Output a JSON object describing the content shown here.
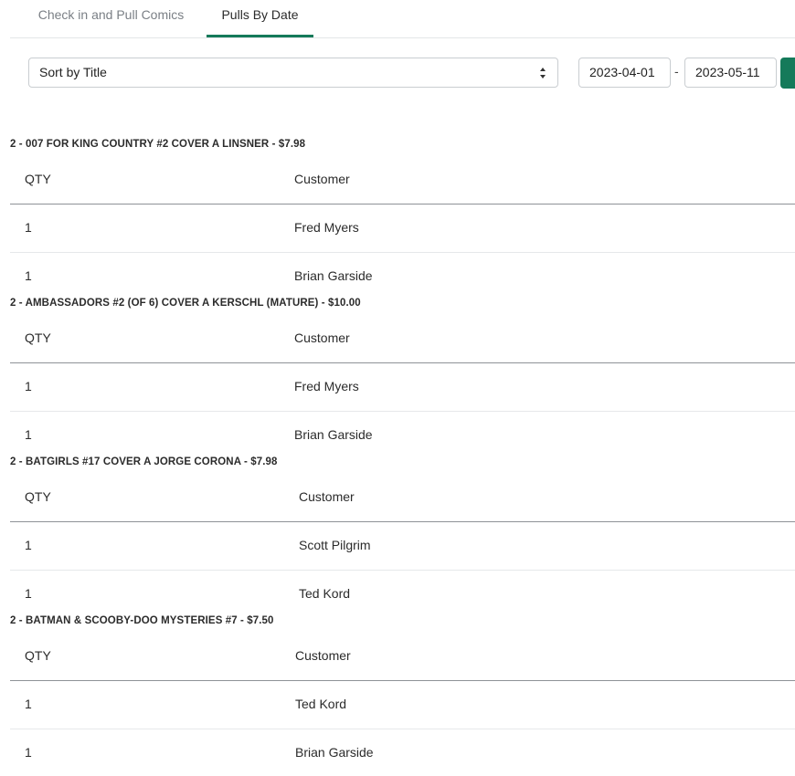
{
  "tabs": [
    {
      "label": "Check in and Pull Comics",
      "active": false
    },
    {
      "label": "Pulls By Date",
      "active": true
    }
  ],
  "filters": {
    "sort_label": "Sort by Title",
    "start_date": "2023-04-01",
    "end_date": "2023-05-11",
    "date_separator": "-"
  },
  "colors": {
    "accent": "#157a5a"
  },
  "table_headers": {
    "qty": "QTY",
    "customer": "Customer"
  },
  "groups": [
    {
      "title": "2 - 007 FOR KING COUNTRY #2 COVER A LINSNER - $7.98",
      "rows": [
        {
          "qty": "1",
          "customer": "Fred Myers"
        },
        {
          "qty": "1",
          "customer": "Brian Garside"
        }
      ]
    },
    {
      "title": "2 - AMBASSADORS #2 (OF 6) COVER A KERSCHL (MATURE) - $10.00",
      "rows": [
        {
          "qty": "1",
          "customer": "Fred Myers"
        },
        {
          "qty": "1",
          "customer": "Brian Garside"
        }
      ]
    },
    {
      "title": "2 - BATGIRLS #17 COVER A JORGE CORONA - $7.98",
      "rows": [
        {
          "qty": "1",
          "customer": "Scott Pilgrim"
        },
        {
          "qty": "1",
          "customer": "Ted Kord"
        }
      ]
    },
    {
      "title": "2 - BATMAN & SCOOBY-DOO MYSTERIES #7 - $7.50",
      "rows": [
        {
          "qty": "1",
          "customer": "Ted Kord"
        },
        {
          "qty": "1",
          "customer": "Brian Garside"
        }
      ]
    }
  ]
}
